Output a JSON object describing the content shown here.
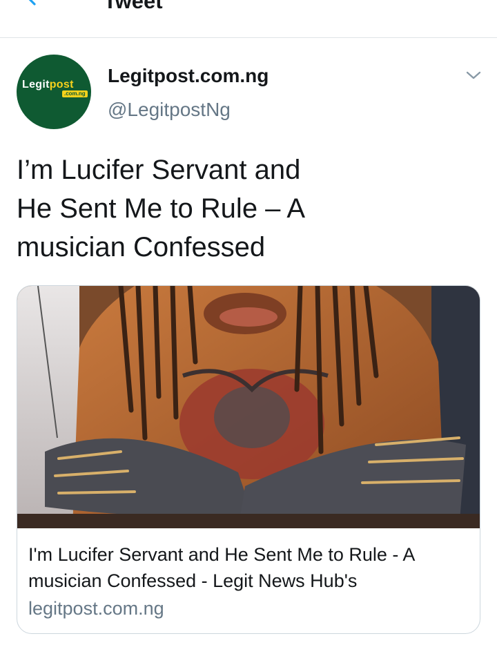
{
  "header": {
    "title": "Tweet"
  },
  "tweet": {
    "author": {
      "name": "Legitpost.com.ng",
      "handle": "@LegitpostNg",
      "avatar": {
        "logo_main": "Legit",
        "logo_accent": "post",
        "logo_sub": ".com.ng"
      }
    },
    "text_lines": [
      "I’m Lucifer Servant and",
      "He Sent Me to Rule – A",
      "musician Confessed"
    ],
    "card": {
      "title_lines": [
        "I'm Lucifer Servant and He Sent Me to Rule - A",
        "musician Confessed - Legit News Hub's"
      ],
      "domain": "legitpost.com.ng"
    }
  },
  "icons": {
    "back": "arrow-left-icon",
    "caret": "chevron-down-icon"
  },
  "colors": {
    "accent": "#1da1f2",
    "secondary_text": "#657786",
    "primary_text": "#14171a",
    "border": "#ccd6dd",
    "avatar_green": "#0f5a32",
    "avatar_yellow": "#f7d21c"
  }
}
